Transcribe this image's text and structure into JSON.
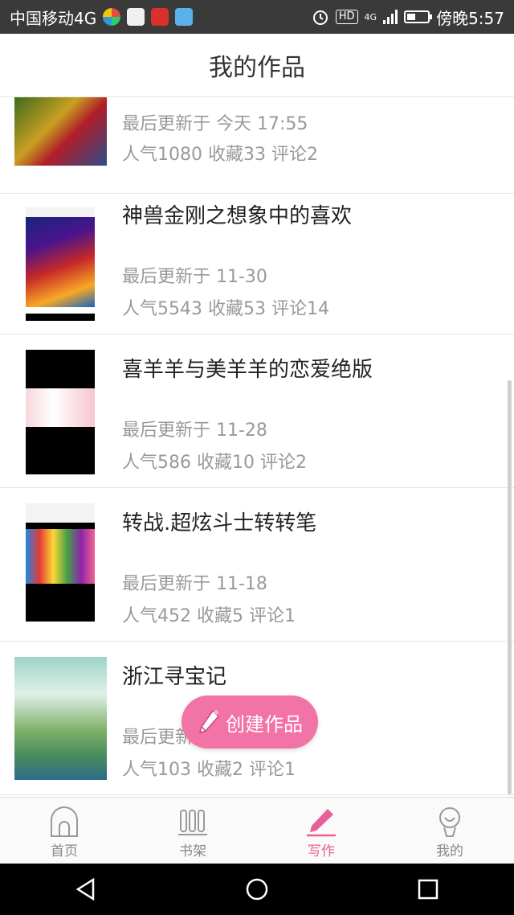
{
  "status_bar": {
    "carrier": "中国移动4G",
    "time": "傍晚5:57",
    "hd_label": "HD",
    "network_label": "4G",
    "battery_level_percent": 40,
    "icons": [
      "wechat-icon",
      "app-icon",
      "news-icon",
      "browser-icon",
      "alarm-icon",
      "hd-icon",
      "signal-icon",
      "battery-icon"
    ]
  },
  "header": {
    "title": "我的作品"
  },
  "works": [
    {
      "title": "",
      "updated": "最后更新于 今天 17:55",
      "stats": "人气1080 收藏33 评论2"
    },
    {
      "title": "神兽金刚之想象中的喜欢",
      "updated": "最后更新于 11-30",
      "stats": "人气5543 收藏53 评论14"
    },
    {
      "title": "喜羊羊与美羊羊的恋爱绝版",
      "updated": "最后更新于 11-28",
      "stats": "人气586 收藏10 评论2"
    },
    {
      "title": "转战.超炫斗士转转笔",
      "updated": "最后更新于 11-18",
      "stats": "人气452 收藏5 评论1"
    },
    {
      "title": "浙江寻宝记",
      "updated": "最后更新于 11-18",
      "stats": "人气103 收藏2 评论1"
    }
  ],
  "fab": {
    "label": "创建作品",
    "icon": "pencil-icon"
  },
  "tabs": [
    {
      "label": "首页",
      "icon": "home-icon"
    },
    {
      "label": "书架",
      "icon": "bookshelf-icon"
    },
    {
      "label": "写作",
      "icon": "write-icon",
      "active": true
    },
    {
      "label": "我的",
      "icon": "profile-icon"
    }
  ],
  "colors": {
    "accent": "#e85f97",
    "fab": "#f274a6",
    "status_bar": "#3a3a3a"
  }
}
